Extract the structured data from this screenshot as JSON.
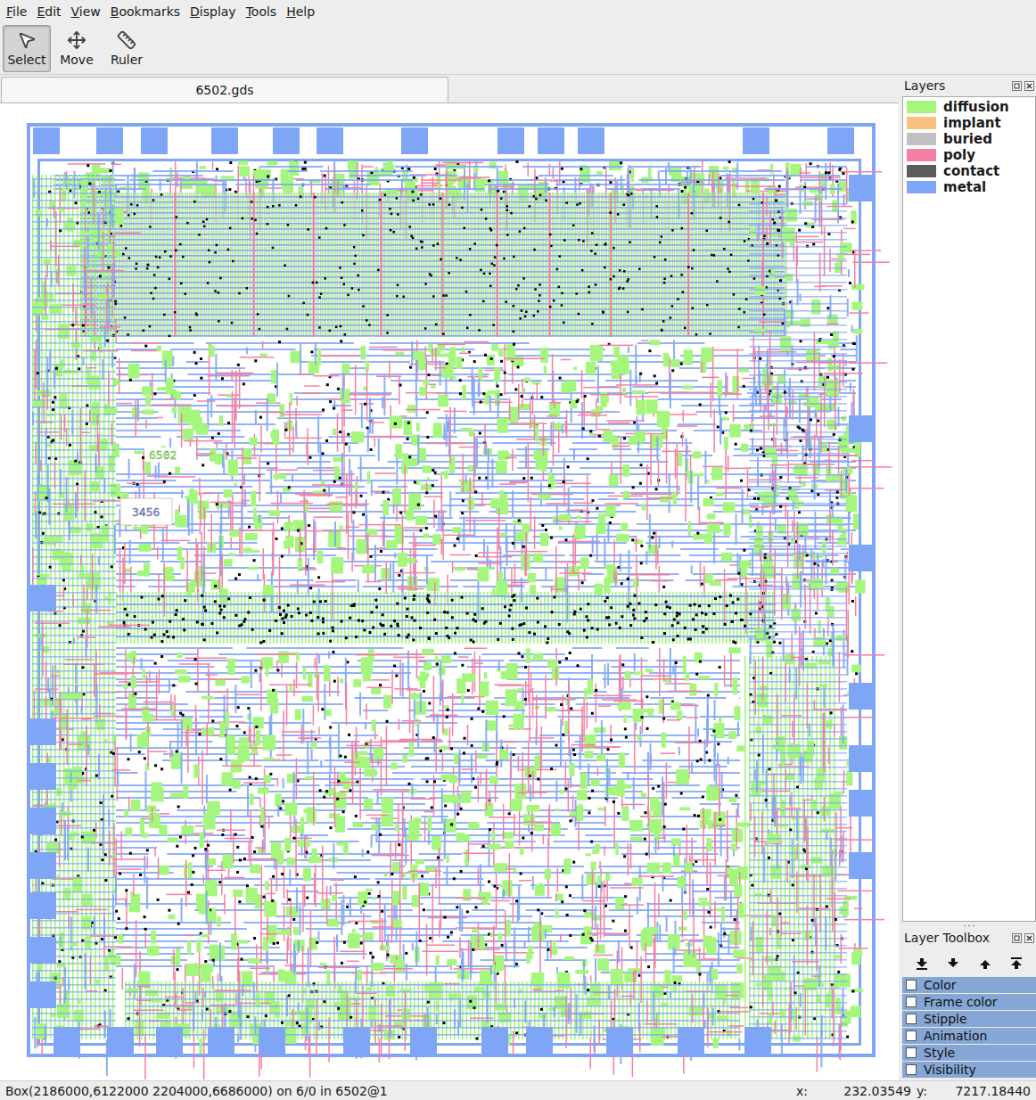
{
  "menu": [
    "File",
    "Edit",
    "View",
    "Bookmarks",
    "Display",
    "Tools",
    "Help"
  ],
  "toolbar": [
    {
      "label": "Select",
      "selected": true
    },
    {
      "label": "Move",
      "selected": false
    },
    {
      "label": "Ruler",
      "selected": false
    }
  ],
  "tabs": [
    {
      "label": "6502.gds",
      "selected": true
    }
  ],
  "layout": {
    "cell_labels": [
      "6502",
      "3456"
    ]
  },
  "layers_panel": {
    "title": "Layers",
    "layers": [
      {
        "name": "diffusion",
        "color": "#a4f67c"
      },
      {
        "name": "implant",
        "color": "#f9c37f"
      },
      {
        "name": "buried",
        "color": "#c0c0c0"
      },
      {
        "name": "poly",
        "color": "#f57fa2"
      },
      {
        "name": "contact",
        "color": "#5c5c5c"
      },
      {
        "name": "metal",
        "color": "#7fa5f6"
      }
    ]
  },
  "layer_toolbox": {
    "title": "Layer Toolbox",
    "sections": [
      {
        "label": "Color",
        "expanded": false
      },
      {
        "label": "Frame color",
        "expanded": false
      },
      {
        "label": "Stipple",
        "expanded": false
      },
      {
        "label": "Animation",
        "expanded": false
      },
      {
        "label": "Style",
        "expanded": false
      },
      {
        "label": "Visibility",
        "expanded": false
      }
    ]
  },
  "status_bar": {
    "message": "Box(2186000,6122000 2204000,6686000) on 6/0 in 6502@1",
    "x_label": "x:",
    "x": "232.03549",
    "y_label": "y:",
    "y": "7217.18440"
  }
}
